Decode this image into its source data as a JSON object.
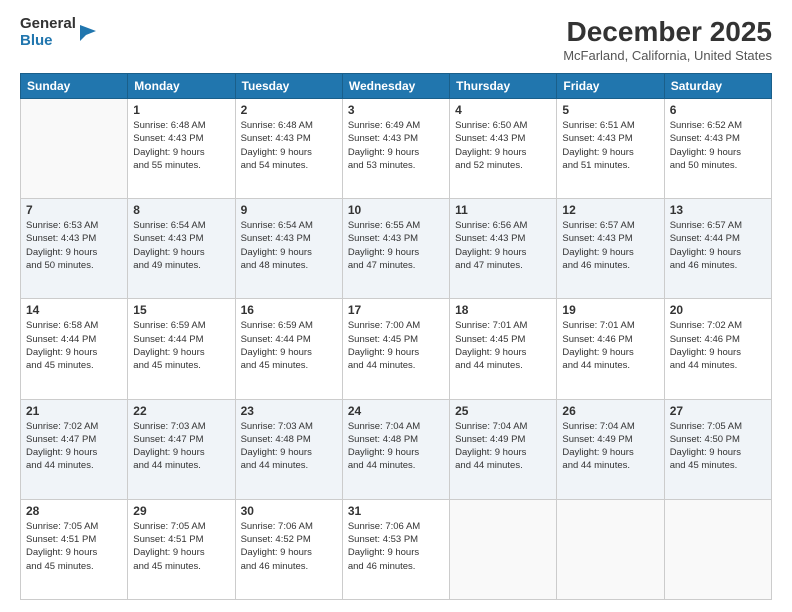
{
  "logo": {
    "general": "General",
    "blue": "Blue"
  },
  "header": {
    "month": "December 2025",
    "location": "McFarland, California, United States"
  },
  "days_of_week": [
    "Sunday",
    "Monday",
    "Tuesday",
    "Wednesday",
    "Thursday",
    "Friday",
    "Saturday"
  ],
  "weeks": [
    [
      {
        "day": "",
        "info": ""
      },
      {
        "day": "1",
        "info": "Sunrise: 6:48 AM\nSunset: 4:43 PM\nDaylight: 9 hours\nand 55 minutes."
      },
      {
        "day": "2",
        "info": "Sunrise: 6:48 AM\nSunset: 4:43 PM\nDaylight: 9 hours\nand 54 minutes."
      },
      {
        "day": "3",
        "info": "Sunrise: 6:49 AM\nSunset: 4:43 PM\nDaylight: 9 hours\nand 53 minutes."
      },
      {
        "day": "4",
        "info": "Sunrise: 6:50 AM\nSunset: 4:43 PM\nDaylight: 9 hours\nand 52 minutes."
      },
      {
        "day": "5",
        "info": "Sunrise: 6:51 AM\nSunset: 4:43 PM\nDaylight: 9 hours\nand 51 minutes."
      },
      {
        "day": "6",
        "info": "Sunrise: 6:52 AM\nSunset: 4:43 PM\nDaylight: 9 hours\nand 50 minutes."
      }
    ],
    [
      {
        "day": "7",
        "info": "Sunrise: 6:53 AM\nSunset: 4:43 PM\nDaylight: 9 hours\nand 50 minutes."
      },
      {
        "day": "8",
        "info": "Sunrise: 6:54 AM\nSunset: 4:43 PM\nDaylight: 9 hours\nand 49 minutes."
      },
      {
        "day": "9",
        "info": "Sunrise: 6:54 AM\nSunset: 4:43 PM\nDaylight: 9 hours\nand 48 minutes."
      },
      {
        "day": "10",
        "info": "Sunrise: 6:55 AM\nSunset: 4:43 PM\nDaylight: 9 hours\nand 47 minutes."
      },
      {
        "day": "11",
        "info": "Sunrise: 6:56 AM\nSunset: 4:43 PM\nDaylight: 9 hours\nand 47 minutes."
      },
      {
        "day": "12",
        "info": "Sunrise: 6:57 AM\nSunset: 4:43 PM\nDaylight: 9 hours\nand 46 minutes."
      },
      {
        "day": "13",
        "info": "Sunrise: 6:57 AM\nSunset: 4:44 PM\nDaylight: 9 hours\nand 46 minutes."
      }
    ],
    [
      {
        "day": "14",
        "info": "Sunrise: 6:58 AM\nSunset: 4:44 PM\nDaylight: 9 hours\nand 45 minutes."
      },
      {
        "day": "15",
        "info": "Sunrise: 6:59 AM\nSunset: 4:44 PM\nDaylight: 9 hours\nand 45 minutes."
      },
      {
        "day": "16",
        "info": "Sunrise: 6:59 AM\nSunset: 4:44 PM\nDaylight: 9 hours\nand 45 minutes."
      },
      {
        "day": "17",
        "info": "Sunrise: 7:00 AM\nSunset: 4:45 PM\nDaylight: 9 hours\nand 44 minutes."
      },
      {
        "day": "18",
        "info": "Sunrise: 7:01 AM\nSunset: 4:45 PM\nDaylight: 9 hours\nand 44 minutes."
      },
      {
        "day": "19",
        "info": "Sunrise: 7:01 AM\nSunset: 4:46 PM\nDaylight: 9 hours\nand 44 minutes."
      },
      {
        "day": "20",
        "info": "Sunrise: 7:02 AM\nSunset: 4:46 PM\nDaylight: 9 hours\nand 44 minutes."
      }
    ],
    [
      {
        "day": "21",
        "info": "Sunrise: 7:02 AM\nSunset: 4:47 PM\nDaylight: 9 hours\nand 44 minutes."
      },
      {
        "day": "22",
        "info": "Sunrise: 7:03 AM\nSunset: 4:47 PM\nDaylight: 9 hours\nand 44 minutes."
      },
      {
        "day": "23",
        "info": "Sunrise: 7:03 AM\nSunset: 4:48 PM\nDaylight: 9 hours\nand 44 minutes."
      },
      {
        "day": "24",
        "info": "Sunrise: 7:04 AM\nSunset: 4:48 PM\nDaylight: 9 hours\nand 44 minutes."
      },
      {
        "day": "25",
        "info": "Sunrise: 7:04 AM\nSunset: 4:49 PM\nDaylight: 9 hours\nand 44 minutes."
      },
      {
        "day": "26",
        "info": "Sunrise: 7:04 AM\nSunset: 4:49 PM\nDaylight: 9 hours\nand 44 minutes."
      },
      {
        "day": "27",
        "info": "Sunrise: 7:05 AM\nSunset: 4:50 PM\nDaylight: 9 hours\nand 45 minutes."
      }
    ],
    [
      {
        "day": "28",
        "info": "Sunrise: 7:05 AM\nSunset: 4:51 PM\nDaylight: 9 hours\nand 45 minutes."
      },
      {
        "day": "29",
        "info": "Sunrise: 7:05 AM\nSunset: 4:51 PM\nDaylight: 9 hours\nand 45 minutes."
      },
      {
        "day": "30",
        "info": "Sunrise: 7:06 AM\nSunset: 4:52 PM\nDaylight: 9 hours\nand 46 minutes."
      },
      {
        "day": "31",
        "info": "Sunrise: 7:06 AM\nSunset: 4:53 PM\nDaylight: 9 hours\nand 46 minutes."
      },
      {
        "day": "",
        "info": ""
      },
      {
        "day": "",
        "info": ""
      },
      {
        "day": "",
        "info": ""
      }
    ]
  ]
}
